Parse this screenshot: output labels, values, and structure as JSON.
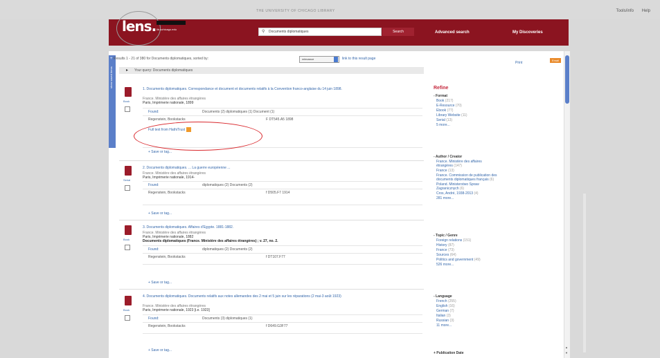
{
  "top": {
    "university": "THE UNIVERSITY OF CHICAGO LIBRARY",
    "links": [
      "Tools/info",
      "Help"
    ]
  },
  "header": {
    "logo": "lens.",
    "logo_sub": "lib.uchicago.edu",
    "search_value": "Documents diplomatiques",
    "search_button": "Search",
    "advanced_search": "Advanced search",
    "my_discoveries": "My Discoveries"
  },
  "sidetab": {
    "label": "show saved items",
    "plus": "+"
  },
  "results": {
    "summary": "Results 1 - 21 of 380 for Documents diplomatiques, sorted by:",
    "sort_value": "relevance",
    "link_to_page": "link to this result page",
    "print": "Print",
    "orange_btn": "Email"
  },
  "query_bar": {
    "text": "Your query: Documents diplomatiques"
  },
  "records": [
    {
      "type": "Book",
      "title": "1. Documents diplomatiques. Correspondance et document et documents relatifs à la Convention franco-anglaise du 14 juin 1898.",
      "author": "France. Ministère des affaires étrangères",
      "pub": "Paris, Imprimerie nationale, 1899",
      "found_label": "Found:",
      "found_counts": "Documents (2) diplomatiques (1) Document (1)",
      "location": "Regenstein, Bookstacks",
      "call": "F DT545.A5 1898",
      "fulltext": "Full text from HathiTrust",
      "save": "+ Save or tag..."
    },
    {
      "type": "Serial",
      "title": "2. Documents diplomatiques. ... La guerre européenne ...",
      "author": "France. Ministère des affaires étrangères",
      "pub": "Paris, Imprimerie nationale, 1914-",
      "found_label": "Found:",
      "found_counts": "diplomatiques (2) Documents (2)",
      "location": "Regenstein, Bookstacks",
      "call": "f D505.F7 1914",
      "save": "+ Save or tag..."
    },
    {
      "type": "Book",
      "title": "3. Documents diplomatiques. Affaires d'Egypte. 1881-1882.",
      "author": "France. Ministère des affaires étrangères",
      "pub": "Paris, Imprimerie nationale, 1882",
      "series": "Documents diplomatiques (France. Ministère des affaires étrangères) ; v. 27, no. 2.",
      "found_label": "Found:",
      "found_counts": "diplomatiques (2) Documents (2)",
      "location": "Regenstein, Bookstacks",
      "call": "f DT107.F77",
      "save": "+ Save or tag..."
    },
    {
      "type": "Book",
      "title": "4. Documents diplomatiques. Documents relatifs aux notes allemandes des 2 mai et 5 juin sur les réparations (2 mai-3 août 1923)",
      "author": "France. Ministère des affaires étrangères",
      "pub": "Paris, Imprimerie nationale, 1923 [i.e. 1923]",
      "found_label": "Found:",
      "found_counts": "Documents (3) diplomatiques (1)",
      "location": "Regenstein, Bookstacks",
      "call": "f D649.G3F77",
      "save": "+ Save or tag..."
    }
  ],
  "refine": {
    "heading": "Refine",
    "format": {
      "title": "- Format",
      "items": [
        [
          "Book",
          "(217)"
        ],
        [
          "E-Resource",
          "(70)"
        ],
        [
          "Ebook",
          "(77)"
        ],
        [
          "Library Website",
          "(11)"
        ],
        [
          "Serial",
          "(13)"
        ],
        [
          "5 more...",
          ""
        ]
      ]
    },
    "author": {
      "title": "- Author / Creator",
      "items": [
        [
          "France. Ministère des affaires",
          ""
        ],
        [
          "étrangères",
          "(147)"
        ],
        [
          "France",
          "(13)"
        ],
        [
          "France. Commission de publication des",
          ""
        ],
        [
          "documents diplomatiques français",
          "(6)"
        ],
        [
          "Poland. Ministerstwo Spraw",
          ""
        ],
        [
          "Zagranicznych",
          "(6)"
        ],
        [
          "Cros, André, 1938-2013",
          "(4)"
        ],
        [
          "281 more...",
          ""
        ]
      ]
    },
    "topic": {
      "title": "- Topic / Genre",
      "items": [
        [
          "Foreign relations",
          "(151)"
        ],
        [
          "History",
          "(87)"
        ],
        [
          "France",
          "(73)"
        ],
        [
          "Sources",
          "(64)"
        ],
        [
          "Politics and government",
          "(49)"
        ],
        [
          "526 more...",
          ""
        ]
      ]
    },
    "language": {
      "title": "- Language",
      "items": [
        [
          "French",
          "(255)"
        ],
        [
          "English",
          "(16)"
        ],
        [
          "German",
          "(7)"
        ],
        [
          "Italian",
          "(3)"
        ],
        [
          "Russian",
          "(3)"
        ],
        [
          "11 more...",
          ""
        ]
      ]
    },
    "pubdate": {
      "title": "+ Publication Date"
    }
  }
}
